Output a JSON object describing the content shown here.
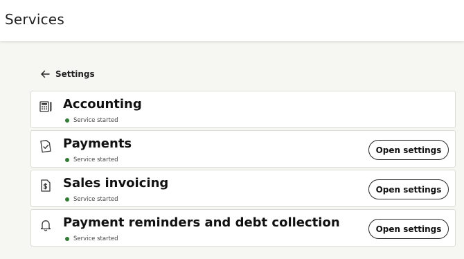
{
  "header": {
    "title": "Services"
  },
  "back": {
    "label": "Settings",
    "icon": "arrow-left-icon"
  },
  "services": [
    {
      "name": "Accounting",
      "icon": "calculator-icon",
      "status": "Service started",
      "status_color": "#2e7d32",
      "button": null
    },
    {
      "name": "Payments",
      "icon": "payment-document-icon",
      "status": "Service started",
      "status_color": "#2e7d32",
      "button": "Open settings"
    },
    {
      "name": "Sales invoicing",
      "icon": "invoice-dollar-icon",
      "status": "Service started",
      "status_color": "#2e7d32",
      "button": "Open settings"
    },
    {
      "name": "Payment reminders and debt collection",
      "icon": "bell-icon",
      "status": "Service started",
      "status_color": "#2e7d32",
      "button": "Open settings"
    }
  ]
}
